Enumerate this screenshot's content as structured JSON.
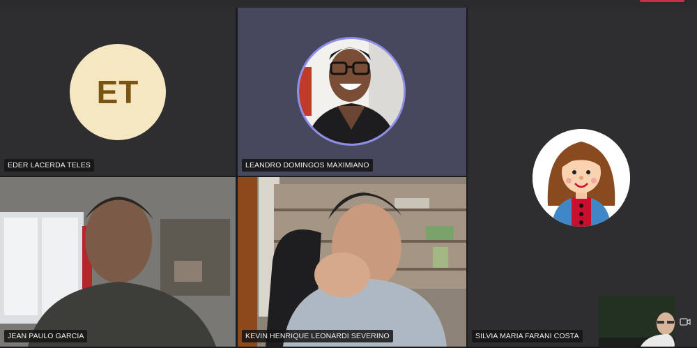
{
  "participants": [
    {
      "id": "eder",
      "name": "EDER LACERDA TELES",
      "initials": "ET"
    },
    {
      "id": "leandro",
      "name": "LEANDRO DOMINGOS MAXIMIANO"
    },
    {
      "id": "silvia",
      "name": "SILVIA MARIA FARANI COSTA"
    },
    {
      "id": "jean",
      "name": "JEAN PAULO GARCIA"
    },
    {
      "id": "kevin",
      "name": "KEVIN HENRIQUE LEONARDI SEVERINO"
    }
  ],
  "colors": {
    "accent": "#8e8ee8",
    "initials_bg": "#f6e7c3",
    "initials_text": "#7a5411",
    "tile_bg": "#2e2e30",
    "leave_red": "#c4314b"
  },
  "icons": {
    "camera": "camera-switch-icon"
  }
}
